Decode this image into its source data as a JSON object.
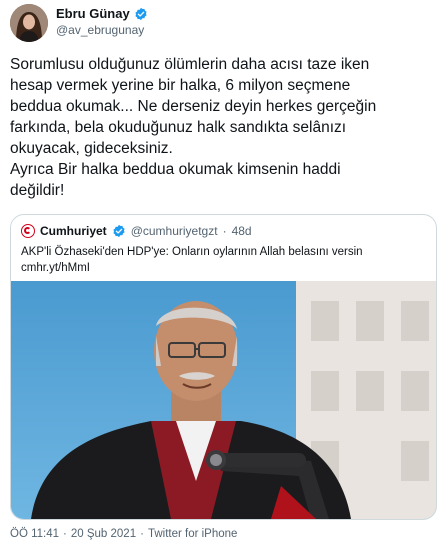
{
  "author": {
    "name": "Ebru Günay",
    "handle": "@av_ebrugunay",
    "verified_icon": "verified-badge-icon"
  },
  "tweet": {
    "lines": [
      "Sorumlusu olduğunuz ölümlerin daha acısı taze iken",
      "hesap vermek yerine bir halka, 6 milyon seçmene",
      "beddua okumak... Ne derseniz deyin herkes gerçeğin",
      "farkında, bela okuduğunuz halk sandıkta selânızı",
      "okuyacak, gideceksiniz.",
      "Ayrıca Bir halka beddua okumak kimsenin haddi",
      "değildir!"
    ]
  },
  "quote": {
    "name": "Cumhuriyet",
    "handle": "@cumhuriyetgzt",
    "dot": "·",
    "time": "48d",
    "text_line1": "AKP'li Özhaseki'den HDP'ye: Onların oylarının Allah belasını versin",
    "text_line2": "cmhr.yt/hMmI"
  },
  "meta": {
    "time": "ÖÖ 11:41",
    "dot1": "·",
    "date": "20 Şub 2021",
    "dot2": "·",
    "source": "Twitter for iPhone"
  },
  "colors": {
    "text": "#0f1419",
    "secondary": "#536471",
    "border": "#cfd9de",
    "verified": "#1d9bf0",
    "cumhuriyet_red": "#d0021b"
  }
}
